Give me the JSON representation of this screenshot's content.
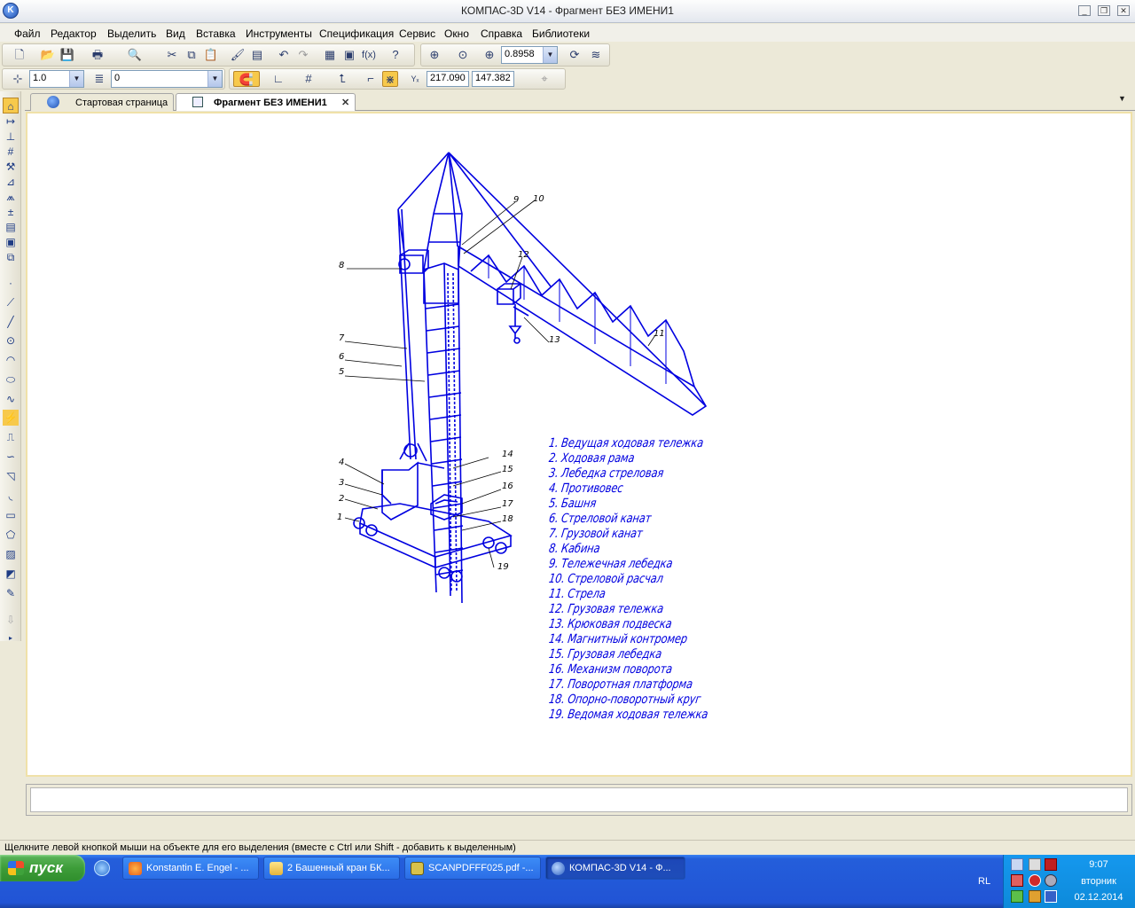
{
  "window": {
    "title": "КОМПАС-3D V14 - Фрагмент БЕЗ ИМЕНИ1"
  },
  "menu": [
    "Файл",
    "Редактор",
    "Выделить",
    "Вид",
    "Вставка",
    "Инструменты",
    "Спецификация",
    "Сервис",
    "Окно",
    "Справка",
    "Библиотеки"
  ],
  "toolbar": {
    "zoom_value": "0.8958",
    "line_scale": "1.0",
    "layer_value": "0",
    "coord_x": "217.090",
    "coord_y": "147.382"
  },
  "tabs": [
    {
      "label": "Стартовая страница",
      "active": false
    },
    {
      "label": "Фрагмент БЕЗ ИМЕНИ1",
      "active": true
    }
  ],
  "drawing": {
    "callouts": [
      "1",
      "2",
      "3",
      "4",
      "5",
      "6",
      "7",
      "8",
      "9",
      "10",
      "11",
      "12",
      "13",
      "14",
      "15",
      "16",
      "17",
      "18",
      "19"
    ],
    "legend": [
      "1. Ведущая ходовая тележка",
      "2. Ходовая рама",
      "3. Лебедка стреловая",
      "4. Противовес",
      "5. Башня",
      "6. Стреловой канат",
      "7. Грузовой канат",
      "8. Кабина",
      "9. Тележечная лебедка",
      "10. Стреловой расчал",
      "11. Стрела",
      "12. Грузовая тележка",
      "13. Крюковая подвеска",
      "14. Магнитный контромер",
      "15. Грузовая лебедка",
      "16. Механизм поворота",
      "17. Поворотная платформа",
      "18. Опорно-поворотный круг",
      "19. Ведомая ходовая тележка"
    ],
    "line_color": "#0000E0"
  },
  "status": {
    "hint": "Щелкните левой кнопкой мыши на объекте для его выделения (вместе с Ctrl или Shift - добавить к выделенным)"
  },
  "taskbar": {
    "start_label": "пуск",
    "buttons": [
      {
        "label": "Konstantin E. Engel - ...",
        "active": false
      },
      {
        "label": "2 Башенный кран БК...",
        "active": false
      },
      {
        "label": "SCANPDFFF025.pdf -...",
        "active": false
      },
      {
        "label": "КОМПАС-3D V14 - Ф...",
        "active": true
      }
    ],
    "lang": "RL",
    "time": "9:07",
    "weekday": "вторник",
    "date": "02.12.2014"
  }
}
